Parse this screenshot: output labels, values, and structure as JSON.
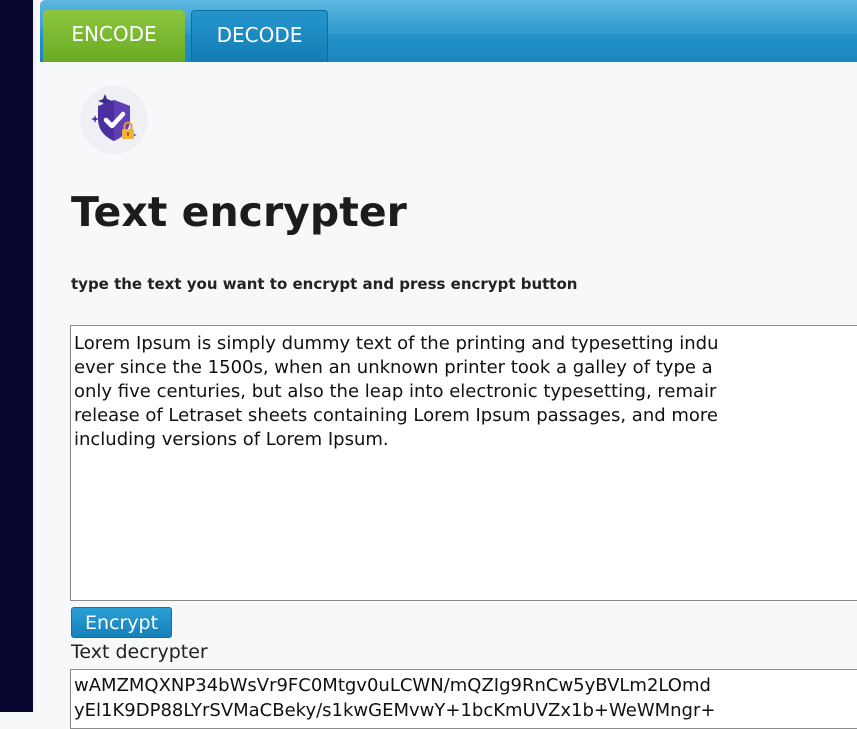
{
  "tabs": {
    "encode": "ENCODE",
    "decode": "DECODE"
  },
  "logo": {
    "icon": "shield-check-lock-icon"
  },
  "page": {
    "title": "Text encrypter",
    "subtitle": "type the text you want to encrypt and press encrypt button"
  },
  "input": {
    "value": "Lorem Ipsum is simply dummy text of the printing and typesetting indu\never since the 1500s, when an unknown printer took a galley of type a\nonly five centuries, but also the leap into electronic typesetting, remair\nrelease of Letraset sheets containing Lorem Ipsum passages, and more\nincluding versions of Lorem Ipsum."
  },
  "encrypt_button": {
    "label": "Encrypt"
  },
  "decrypter": {
    "label": "Text decrypter",
    "value": "wAMZMQXNP34bWsVr9FC0Mtgv0uLCWN/mQZIg9RnCw5yBVLm2LOmd\nyEl1K9DP88LYrSVMaCBeky/s1kwGEMvwY+1bcKmUVZx1b+WeWMngr+"
  },
  "colors": {
    "tab_encode": "#7ab833",
    "tab_bar": "#1f8fc8",
    "button": "#1f8fc8",
    "left_rail": "#07062e"
  }
}
